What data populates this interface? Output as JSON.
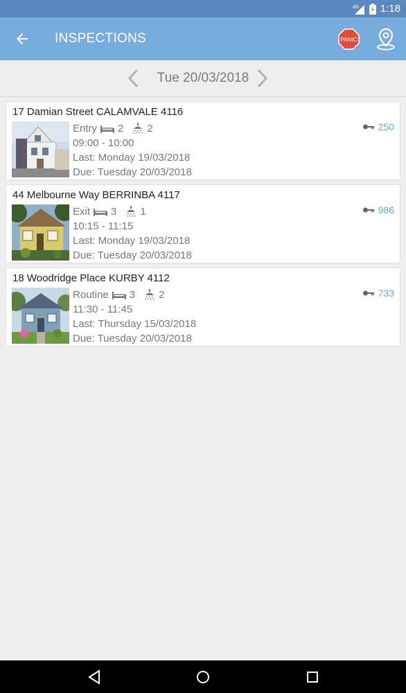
{
  "status_bar": {
    "network": "4G",
    "time": "1:18"
  },
  "app_bar": {
    "title": "INSPECTIONS",
    "panic_label": "PANIC",
    "background": "#78acdc"
  },
  "date_nav": {
    "date": "Tue 20/03/2018"
  },
  "inspections": [
    {
      "address": "17 Damian Street CALAMVALE 4116",
      "type": "Entry",
      "bedrooms": "2",
      "bathrooms": "2",
      "time": "09:00 - 10:00",
      "last": "Last: Monday 19/03/2018",
      "due": "Due:  Tuesday 20/03/2018",
      "key": "250",
      "thumb": "house-photo-white-two-storey"
    },
    {
      "address": "44 Melbourne Way BERRINBA 4117",
      "type": "Exit",
      "bedrooms": "3",
      "bathrooms": "1",
      "time": "10:15 - 11:15",
      "last": "Last: Monday 19/03/2018",
      "due": "Due:  Tuesday 20/03/2018",
      "key": "986",
      "thumb": "house-photo-yellow-cottage"
    },
    {
      "address": "18 Woodridge Place KURBY 4112",
      "type": "Routine",
      "bedrooms": "3",
      "bathrooms": "2",
      "time": "11:30 - 11:45",
      "last": "Last: Thursday 15/03/2018",
      "due": "Due:  Tuesday 20/03/2018",
      "key": "733",
      "thumb": "house-photo-blue-bungalow"
    }
  ],
  "colors": {
    "status_bar": "#5b89bf",
    "accent": "#6aa6d8",
    "panic": "#d9534f"
  }
}
